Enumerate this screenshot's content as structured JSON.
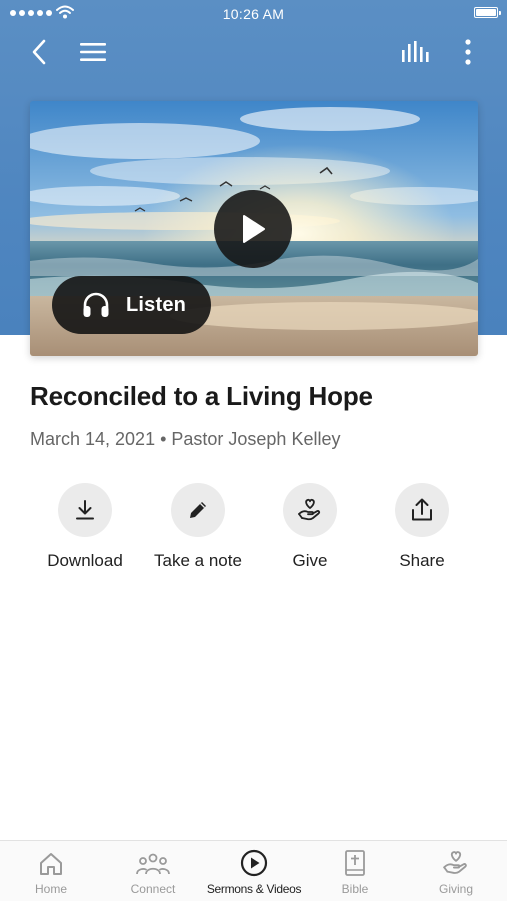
{
  "status_bar": {
    "time": "10:26 AM",
    "icons": [
      "signal-dots-icon",
      "wifi-icon",
      "battery-icon"
    ]
  },
  "topbar": {
    "icons": [
      "back-arrow-icon",
      "hamburger-menu-icon",
      "bar-chart-icon",
      "more-vertical-icon"
    ]
  },
  "media": {
    "image": "ocean-sunrise-with-birds",
    "play_icon": "play-icon",
    "listen_label": "Listen",
    "listen_icon": "headphones-icon"
  },
  "sermon": {
    "title": "Reconciled to a Living Hope",
    "meta": "March 14, 2021 • Pastor Joseph Kelley"
  },
  "actions": [
    {
      "label": "Download",
      "icon": "download-icon"
    },
    {
      "label": "Take a note",
      "icon": "pencil-icon"
    },
    {
      "label": "Give",
      "icon": "heart-hand-icon"
    },
    {
      "label": "Share",
      "icon": "share-icon"
    }
  ],
  "tabs": [
    {
      "label": "Home",
      "icon": "home-icon",
      "active": false
    },
    {
      "label": "Connect",
      "icon": "people-icon",
      "active": false
    },
    {
      "label": "Sermons & Videos",
      "icon": "play-circle-icon",
      "active": true
    },
    {
      "label": "Bible",
      "icon": "bible-icon",
      "active": false
    },
    {
      "label": "Giving",
      "icon": "heart-hand-icon",
      "active": false
    }
  ],
  "colors": {
    "header_blue": "#4f86c0",
    "dark_overlay": "#141414",
    "action_circle": "#ebebeb",
    "tab_inactive": "#9a9a9a",
    "tab_active": "#222222"
  }
}
